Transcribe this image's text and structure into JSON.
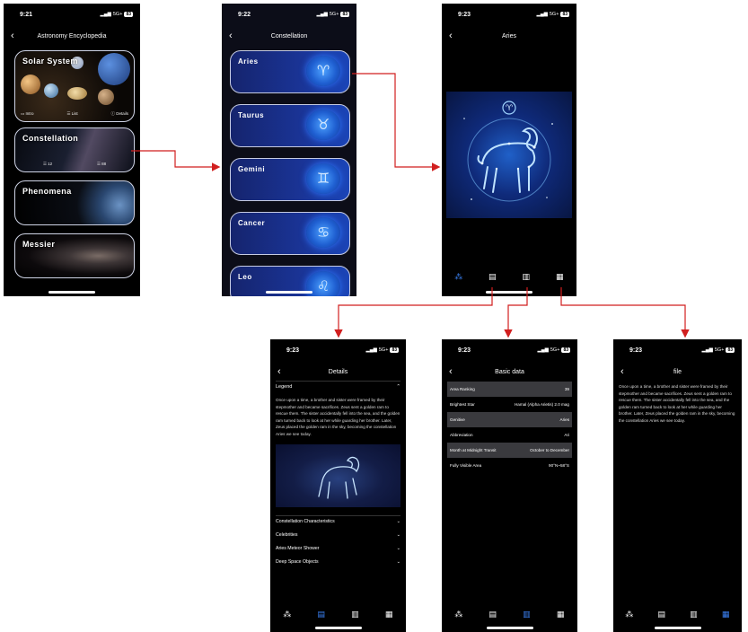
{
  "phones": {
    "encyclopedia": {
      "time": "9:21",
      "network": "5G+",
      "battery": "83",
      "title": "Astronomy Encyclopedia",
      "cards": [
        {
          "label": "Solar System",
          "stats": [
            "Intro",
            "List",
            "Details"
          ]
        },
        {
          "label": "Constellation",
          "stats": [
            "12",
            "88"
          ]
        },
        {
          "label": "Phenomena",
          "stats": []
        },
        {
          "label": "Messier",
          "stats": []
        }
      ]
    },
    "constellation": {
      "time": "9:22",
      "network": "5G+",
      "battery": "83",
      "title": "Constellation",
      "items": [
        "Aries",
        "Taurus",
        "Gemini",
        "Cancer",
        "Leo"
      ],
      "icon_glyphs": [
        "♈",
        "♉",
        "♊",
        "♋",
        "♌"
      ]
    },
    "aries": {
      "time": "9:23",
      "network": "5G+",
      "battery": "83",
      "title": "Aries"
    },
    "details": {
      "time": "9:23",
      "network": "5G+",
      "battery": "83",
      "title": "Details",
      "legend_heading": "Legend",
      "legend_text": "Once upon a time, a brother and sister were framed by their stepmother and became sacrifices. Zeus sent a golden ram to rescue them. The sister accidentally fell into the sea, and the golden ram turned back to look at her while guarding her brother. Later, Zeus placed the golden ram in the sky, becoming the constellation Aries we see today.",
      "sections": [
        "Constellation Characteristics",
        "Celebrities",
        "Aries Meteor Shower",
        "Deep Space Objects"
      ]
    },
    "basic": {
      "time": "9:23",
      "network": "5G+",
      "battery": "83",
      "title": "Basic data",
      "rows": [
        {
          "label": "Area Ranking",
          "value": "39"
        },
        {
          "label": "Brightest Star",
          "value": "Hamal (Alpha Arietis) 2.0 mag"
        },
        {
          "label": "Genitive",
          "value": "Aries"
        },
        {
          "label": "Abbreviation",
          "value": "Ari"
        },
        {
          "label": "Month at Midnight Transit",
          "value": "October to December"
        },
        {
          "label": "Fully Visible Area",
          "value": "90°N~58°S"
        }
      ]
    },
    "file": {
      "time": "9:23",
      "network": "5G+",
      "battery": "83",
      "title": "file",
      "text": "Once upon a time, a brother and sister were framed by their stepmother and became sacrifices. Zeus sent a golden ram to rescue them. The sister accidentally fell into the sea, and the golden ram turned back to look at her while guarding her brother. Later, Zeus placed the golden ram in the sky, becoming the constellation Aries we see today."
    }
  },
  "colors": {
    "accent": "#3b82f6",
    "arrow": "#d11f1f",
    "pill": "#1a3496"
  }
}
